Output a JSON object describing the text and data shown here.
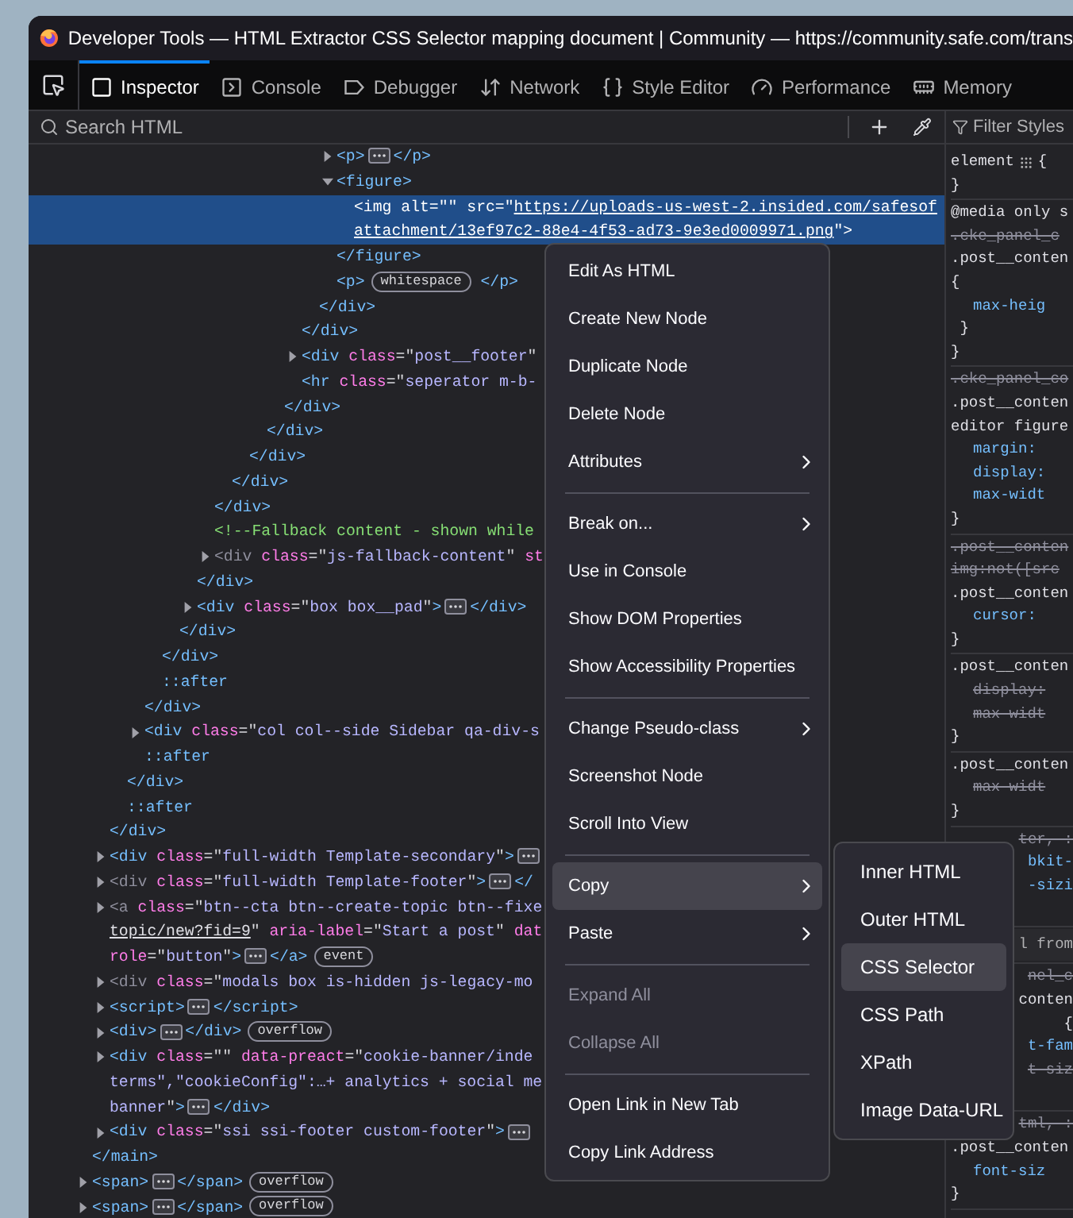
{
  "window": {
    "title": "Developer Tools — HTML Extractor CSS Selector mapping document | Community — https://community.safe.com/trans"
  },
  "tabs": [
    {
      "label": "Inspector",
      "selected": true
    },
    {
      "label": "Console",
      "selected": false
    },
    {
      "label": "Debugger",
      "selected": false
    },
    {
      "label": "Network",
      "selected": false
    },
    {
      "label": "Style Editor",
      "selected": false
    },
    {
      "label": "Performance",
      "selected": false
    },
    {
      "label": "Memory",
      "selected": false
    }
  ],
  "markup_search": {
    "placeholder": "Search HTML"
  },
  "styles_filter": {
    "placeholder": "Filter Styles"
  },
  "dom_tree": [
    {
      "children": [
        {
          "children": [
            {
              "children": [
                {
                  "children": [
                    {
                      "children": [
                        {
                          "children": [
                            {
                              "children": [
                                {
                                  "children": [
                                    {
                                      "children": [
                                        {
                                          "children": [
                                            {
                                              "children": [
                                                {
                                                  "children": [
                                                    {
                                                      "children": [
                                                        {
                                                          "children": [
                                                            {
                                                              "open": [
                                                                {
                                                                  "kind": "tag",
                                                                  "text": "<p>"
                                                                },
                                                                {
                                                                  "kind": "more"
                                                                },
                                                                {
                                                                  "kind": "tag",
                                                                  "text": "</p>"
                                                                }
                                                              ],
                                                              "expanded": false,
                                                              "selected": false
                                                            },
                                                            {
                                                              "open": [
                                                                {
                                                                  "kind": "tag",
                                                                  "text": "<figure>"
                                                                }
                                                              ],
                                                              "expanded": true,
                                                              "selected": false,
                                                              "children": [
                                                                {
                                                                  "open": [
                                                                    {
                                                                      "kind": "tag",
                                                                      "text": "<img "
                                                                    },
                                                                    {
                                                                      "kind": "attr",
                                                                      "text": "alt"
                                                                    },
                                                                    {
                                                                      "kind": "plain",
                                                                      "text": "=\"\" "
                                                                    },
                                                                    {
                                                                      "kind": "attr",
                                                                      "text": "src"
                                                                    },
                                                                    {
                                                                      "kind": "plain",
                                                                      "text": "=\""
                                                                    },
                                                                    {
                                                                      "kind": "link",
                                                                      "text": "https://uploads-us-west-2.insided.com/safesof"
                                                                    },
                                                                    {
                                                                      "kind": "break"
                                                                    },
                                                                    {
                                                                      "kind": "link",
                                                                      "text": "attachment/13ef97c2-88e4-4f53-ad73-9e3ed0009971.png"
                                                                    },
                                                                    {
                                                                      "kind": "plain",
                                                                      "text": "\""
                                                                    },
                                                                    {
                                                                      "kind": "tag",
                                                                      "text": ">"
                                                                    }
                                                                  ],
                                                                  "selected": true
                                                                }
                                                              ],
                                                              "close": [
                                                                {
                                                                  "kind": "tag",
                                                                  "text": "</figure>"
                                                                }
                                                              ]
                                                            },
                                                            {
                                                              "open": [
                                                                {
                                                                  "kind": "tag",
                                                                  "text": "<p>"
                                                                },
                                                                {
                                                                  "kind": "badge",
                                                                  "text": "whitespace"
                                                                },
                                                                {
                                                                  "kind": "tag",
                                                                  "text": " </p>"
                                                                }
                                                              ],
                                                              "selected": false
                                                            }
                                                          ],
                                                          "close": [
                                                            {
                                                              "kind": "tag",
                                                              "text": "</div>"
                                                            }
                                                          ]
                                                        }
                                                      ],
                                                      "close": [
                                                        {
                                                          "kind": "tag",
                                                          "text": "</div>"
                                                        }
                                                      ]
                                                    },
                                                    {
                                                      "open": [
                                                        {
                                                          "kind": "tag",
                                                          "text": "<div "
                                                        },
                                                        {
                                                          "kind": "attr",
                                                          "text": "class"
                                                        },
                                                        {
                                                          "kind": "plain",
                                                          "text": "=\""
                                                        },
                                                        {
                                                          "kind": "value",
                                                          "text": "post__footer"
                                                        },
                                                        {
                                                          "kind": "plain",
                                                          "text": "\""
                                                        }
                                                      ],
                                                      "expanded": false,
                                                      "selected": false
                                                    },
                                                    {
                                                      "open": [
                                                        {
                                                          "kind": "tag",
                                                          "text": "<hr "
                                                        },
                                                        {
                                                          "kind": "attr",
                                                          "text": "class"
                                                        },
                                                        {
                                                          "kind": "plain",
                                                          "text": "=\""
                                                        },
                                                        {
                                                          "kind": "value",
                                                          "text": "seperator m-b-"
                                                        }
                                                      ],
                                                      "selected": false
                                                    }
                                                  ],
                                                  "close": [
                                                    {
                                                      "kind": "tag",
                                                      "text": "</div>"
                                                    }
                                                  ]
                                                }
                                              ],
                                              "close": [
                                                {
                                                  "kind": "tag",
                                                  "text": "</div>"
                                                }
                                              ]
                                            }
                                          ],
                                          "close": [
                                            {
                                              "kind": "tag",
                                              "text": "</div>"
                                            }
                                          ]
                                        }
                                      ],
                                      "close": [
                                        {
                                          "kind": "tag",
                                          "text": "</div>"
                                        }
                                      ]
                                    }
                                  ],
                                  "close": [
                                    {
                                      "kind": "tag",
                                      "text": "</div>"
                                    }
                                  ]
                                },
                                {
                                  "open": [
                                    {
                                      "kind": "comment",
                                      "text": "<!--Fallback content - shown while"
                                    }
                                  ],
                                  "selected": false
                                },
                                {
                                  "open": [
                                    {
                                      "kind": "dim",
                                      "text": "<div "
                                    },
                                    {
                                      "kind": "attr",
                                      "text": "class"
                                    },
                                    {
                                      "kind": "plain",
                                      "text": "=\""
                                    },
                                    {
                                      "kind": "value",
                                      "text": "js-fallback-content"
                                    },
                                    {
                                      "kind": "plain",
                                      "text": "\" "
                                    },
                                    {
                                      "kind": "attr",
                                      "text": "st"
                                    }
                                  ],
                                  "expanded": false,
                                  "selected": false
                                }
                              ],
                              "close": [
                                {
                                  "kind": "tag",
                                  "text": "</div>"
                                }
                              ]
                            },
                            {
                              "open": [
                                {
                                  "kind": "tag",
                                  "text": "<div "
                                },
                                {
                                  "kind": "attr",
                                  "text": "class"
                                },
                                {
                                  "kind": "plain",
                                  "text": "=\""
                                },
                                {
                                  "kind": "value",
                                  "text": "box box__pad"
                                },
                                {
                                  "kind": "plain",
                                  "text": "\""
                                },
                                {
                                  "kind": "tag",
                                  "text": ">"
                                },
                                {
                                  "kind": "more"
                                },
                                {
                                  "kind": "tag",
                                  "text": "</div>"
                                }
                              ],
                              "expanded": false,
                              "selected": false
                            }
                          ],
                          "close": [
                            {
                              "kind": "tag",
                              "text": "</div>"
                            }
                          ]
                        }
                      ],
                      "close": [
                        {
                          "kind": "tag",
                          "text": "</div>"
                        }
                      ]
                    },
                    {
                      "open": [
                        {
                          "kind": "tag",
                          "text": "::after"
                        }
                      ],
                      "selected": false
                    }
                  ],
                  "close": [
                    {
                      "kind": "tag",
                      "text": "</div>"
                    }
                  ]
                },
                {
                  "open": [
                    {
                      "kind": "tag",
                      "text": "<div "
                    },
                    {
                      "kind": "attr",
                      "text": "class"
                    },
                    {
                      "kind": "plain",
                      "text": "=\""
                    },
                    {
                      "kind": "value",
                      "text": "col col--side Sidebar qa-div-s"
                    }
                  ],
                  "expanded": false,
                  "selected": false
                },
                {
                  "open": [
                    {
                      "kind": "tag",
                      "text": "::after"
                    }
                  ],
                  "selected": false
                }
              ],
              "close": [
                {
                  "kind": "tag",
                  "text": "</div>"
                }
              ]
            },
            {
              "open": [
                {
                  "kind": "tag",
                  "text": "::after"
                }
              ],
              "selected": false
            }
          ],
          "close": [
            {
              "kind": "tag",
              "text": "</div>"
            }
          ]
        },
        {
          "open": [
            {
              "kind": "tag",
              "text": "<div "
            },
            {
              "kind": "attr",
              "text": "class"
            },
            {
              "kind": "plain",
              "text": "=\""
            },
            {
              "kind": "value",
              "text": "full-width Template-secondary"
            },
            {
              "kind": "plain",
              "text": "\""
            },
            {
              "kind": "tag",
              "text": ">"
            },
            {
              "kind": "more"
            }
          ],
          "expanded": false,
          "selected": false
        },
        {
          "open": [
            {
              "kind": "dim",
              "text": "<div "
            },
            {
              "kind": "attr",
              "text": "class"
            },
            {
              "kind": "plain",
              "text": "=\""
            },
            {
              "kind": "value",
              "text": "full-width Template-footer"
            },
            {
              "kind": "plain",
              "text": "\""
            },
            {
              "kind": "tag",
              "text": ">"
            },
            {
              "kind": "more"
            },
            {
              "kind": "tag",
              "text": "</"
            }
          ],
          "expanded": false,
          "selected": false
        },
        {
          "open": [
            {
              "kind": "dim",
              "text": "<a "
            },
            {
              "kind": "attr",
              "text": "class"
            },
            {
              "kind": "plain",
              "text": "=\""
            },
            {
              "kind": "value",
              "text": "btn--cta btn--create-topic btn--fixe"
            },
            {
              "kind": "break"
            },
            {
              "kind": "link",
              "text": "topic/new?fid=9"
            },
            {
              "kind": "plain",
              "text": "\" "
            },
            {
              "kind": "attr",
              "text": "aria-label"
            },
            {
              "kind": "plain",
              "text": "=\""
            },
            {
              "kind": "value",
              "text": "Start a post"
            },
            {
              "kind": "plain",
              "text": "\" "
            },
            {
              "kind": "attr",
              "text": "dat"
            },
            {
              "kind": "break"
            },
            {
              "kind": "attr",
              "text": "role"
            },
            {
              "kind": "plain",
              "text": "=\""
            },
            {
              "kind": "value",
              "text": "button"
            },
            {
              "kind": "plain",
              "text": "\""
            },
            {
              "kind": "tag",
              "text": ">"
            },
            {
              "kind": "more"
            },
            {
              "kind": "tag",
              "text": "</a>"
            },
            {
              "kind": "badge",
              "text": "event"
            }
          ],
          "expanded": false,
          "selected": false
        },
        {
          "open": [
            {
              "kind": "dim",
              "text": "<div "
            },
            {
              "kind": "attr",
              "text": "class"
            },
            {
              "kind": "plain",
              "text": "=\""
            },
            {
              "kind": "value",
              "text": "modals box is-hidden js-legacy-mo"
            }
          ],
          "expanded": false,
          "selected": false
        },
        {
          "open": [
            {
              "kind": "tag",
              "text": "<script>"
            },
            {
              "kind": "more"
            },
            {
              "kind": "tag",
              "text": "</script>"
            }
          ],
          "expanded": false,
          "selected": false
        },
        {
          "open": [
            {
              "kind": "tag",
              "text": "<div>"
            },
            {
              "kind": "more"
            },
            {
              "kind": "tag",
              "text": "</div>"
            },
            {
              "kind": "badge",
              "text": "overflow"
            }
          ],
          "expanded": false,
          "selected": false
        },
        {
          "open": [
            {
              "kind": "tag",
              "text": "<div "
            },
            {
              "kind": "attr",
              "text": "class"
            },
            {
              "kind": "plain",
              "text": "=\"\" "
            },
            {
              "kind": "attr",
              "text": "data-preact"
            },
            {
              "kind": "plain",
              "text": "=\""
            },
            {
              "kind": "value",
              "text": "cookie-banner/inde"
            },
            {
              "kind": "break"
            },
            {
              "kind": "value",
              "text": "terms\",\"cookieConfig\":…+ analytics + social me"
            },
            {
              "kind": "break"
            },
            {
              "kind": "value",
              "text": "banner"
            },
            {
              "kind": "plain",
              "text": "\""
            },
            {
              "kind": "tag",
              "text": ">"
            },
            {
              "kind": "more"
            },
            {
              "kind": "tag",
              "text": "</div>"
            }
          ],
          "expanded": false,
          "selected": false
        },
        {
          "open": [
            {
              "kind": "tag",
              "text": "<div "
            },
            {
              "kind": "attr",
              "text": "class"
            },
            {
              "kind": "plain",
              "text": "=\""
            },
            {
              "kind": "value",
              "text": "ssi ssi-footer custom-footer"
            },
            {
              "kind": "plain",
              "text": "\""
            },
            {
              "kind": "tag",
              "text": ">"
            },
            {
              "kind": "more"
            }
          ],
          "expanded": false,
          "selected": false
        }
      ],
      "close": [
        {
          "kind": "tag",
          "text": "</main>"
        }
      ]
    },
    {
      "open": [
        {
          "kind": "tag",
          "text": "<span>"
        },
        {
          "kind": "more"
        },
        {
          "kind": "tag",
          "text": "</span>"
        },
        {
          "kind": "badge",
          "text": "overflow"
        }
      ],
      "expanded": false,
      "selected": false
    },
    {
      "open": [
        {
          "kind": "tag",
          "text": "<span>"
        },
        {
          "kind": "more"
        },
        {
          "kind": "tag",
          "text": "</span>"
        },
        {
          "kind": "badge",
          "text": "overflow"
        }
      ],
      "expanded": false,
      "selected": false
    }
  ],
  "style_rules": [
    {
      "lines": [
        {
          "kind": "element",
          "text": "element",
          "suffix": "{",
          "strike": false
        },
        {
          "kind": "sel",
          "text": "}",
          "strike": false
        }
      ]
    },
    {
      "lines": [
        {
          "kind": "sel",
          "text": "@media only s",
          "strike": false
        },
        {
          "kind": "sel",
          "text": ".cke_panel_c",
          "strike": true
        },
        {
          "kind": "sel",
          "text": ".post__conten",
          "strike": false
        },
        {
          "kind": "sel",
          "text": "{",
          "strike": false
        },
        {
          "kind": "prop",
          "text": "max-heig",
          "strike": false
        },
        {
          "kind": "sel",
          "text": " }",
          "strike": false
        },
        {
          "kind": "sel",
          "text": "}",
          "strike": false
        }
      ]
    },
    {
      "lines": [
        {
          "kind": "sel",
          "text": ".cke_panel_co",
          "strike": true
        },
        {
          "kind": "sel",
          "text": ".post__conten",
          "strike": false
        },
        {
          "kind": "sel",
          "text": "editor figure",
          "strike": false
        },
        {
          "kind": "prop",
          "text": "margin:",
          "strike": false
        },
        {
          "kind": "prop",
          "text": "display:",
          "strike": false
        },
        {
          "kind": "prop",
          "text": "max-widt",
          "strike": false
        },
        {
          "kind": "sel",
          "text": "}",
          "strike": false
        }
      ]
    },
    {
      "lines": [
        {
          "kind": "sel",
          "text": ".post__conten",
          "strike": true
        },
        {
          "kind": "sel",
          "text": "img:not([src",
          "strike": true
        },
        {
          "kind": "sel",
          "text": ".post__conten",
          "strike": false
        },
        {
          "kind": "prop",
          "text": "cursor:",
          "strike": false
        },
        {
          "kind": "sel",
          "text": "}",
          "strike": false
        }
      ]
    },
    {
      "lines": [
        {
          "kind": "sel",
          "text": ".post__conten",
          "strike": false
        },
        {
          "kind": "prop",
          "text": "display:",
          "strike": true
        },
        {
          "kind": "prop",
          "text": "max-widt",
          "strike": true
        },
        {
          "kind": "sel",
          "text": "}",
          "strike": false
        }
      ]
    },
    {
      "lines": [
        {
          "kind": "sel",
          "text": ".post__conten",
          "strike": false
        },
        {
          "kind": "prop",
          "text": "max-widt",
          "strike": true
        },
        {
          "kind": "sel",
          "text": "}",
          "strike": false
        }
      ]
    },
    {
      "lines": [
        {
          "kind": "partial",
          "text": "ter, :",
          "strike": true
        },
        {
          "kind": "partial-prop",
          "text": "bkit-",
          "strike": false
        },
        {
          "kind": "partial-prop",
          "text": "-sizi",
          "strike": false
        }
      ]
    },
    {
      "lines": [
        {
          "kind": "head",
          "text": "l from",
          "strike": false
        }
      ]
    },
    {
      "lines": [
        {
          "kind": "partial",
          "text": "nel_c",
          "strike": true
        },
        {
          "kind": "partial",
          "text": "conten",
          "strike": false
        },
        {
          "kind": "partial",
          "text": "{",
          "strike": false
        },
        {
          "kind": "partial-prop",
          "text": "t-fam",
          "strike": false
        },
        {
          "kind": "partial-prop",
          "text": "t-siz",
          "strike": true
        }
      ]
    },
    {
      "lines": [
        {
          "kind": "partial",
          "text": "tml, :",
          "strike": true
        },
        {
          "kind": "sel",
          "text": ".post__conten",
          "strike": false
        },
        {
          "kind": "prop",
          "text": "font-siz",
          "strike": false
        },
        {
          "kind": "sel",
          "text": "}",
          "strike": false
        }
      ]
    }
  ],
  "context_menu": {
    "items": [
      {
        "kind": "item",
        "label": "Edit As HTML",
        "submenu": false,
        "selected": false,
        "disabled": false
      },
      {
        "kind": "item",
        "label": "Create New Node",
        "submenu": false,
        "selected": false,
        "disabled": false
      },
      {
        "kind": "item",
        "label": "Duplicate Node",
        "submenu": false,
        "selected": false,
        "disabled": false
      },
      {
        "kind": "item",
        "label": "Delete Node",
        "submenu": false,
        "selected": false,
        "disabled": false
      },
      {
        "kind": "item",
        "label": "Attributes",
        "submenu": true,
        "selected": false,
        "disabled": false
      },
      {
        "kind": "separator"
      },
      {
        "kind": "item",
        "label": "Break on...",
        "submenu": true,
        "selected": false,
        "disabled": false
      },
      {
        "kind": "item",
        "label": "Use in Console",
        "submenu": false,
        "selected": false,
        "disabled": false
      },
      {
        "kind": "item",
        "label": "Show DOM Properties",
        "submenu": false,
        "selected": false,
        "disabled": false
      },
      {
        "kind": "item",
        "label": "Show Accessibility Properties",
        "submenu": false,
        "selected": false,
        "disabled": false
      },
      {
        "kind": "separator"
      },
      {
        "kind": "item",
        "label": "Change Pseudo-class",
        "submenu": true,
        "selected": false,
        "disabled": false
      },
      {
        "kind": "item",
        "label": "Screenshot Node",
        "submenu": false,
        "selected": false,
        "disabled": false
      },
      {
        "kind": "item",
        "label": "Scroll Into View",
        "submenu": false,
        "selected": false,
        "disabled": false
      },
      {
        "kind": "separator"
      },
      {
        "kind": "item",
        "label": "Copy",
        "submenu": true,
        "selected": true,
        "disabled": false
      },
      {
        "kind": "item",
        "label": "Paste",
        "submenu": true,
        "selected": false,
        "disabled": false
      },
      {
        "kind": "separator"
      },
      {
        "kind": "item",
        "label": "Expand All",
        "submenu": false,
        "selected": false,
        "disabled": true
      },
      {
        "kind": "item",
        "label": "Collapse All",
        "submenu": false,
        "selected": false,
        "disabled": true
      },
      {
        "kind": "separator"
      },
      {
        "kind": "item",
        "label": "Open Link in New Tab",
        "submenu": false,
        "selected": false,
        "disabled": false
      },
      {
        "kind": "item",
        "label": "Copy Link Address",
        "submenu": false,
        "selected": false,
        "disabled": false
      }
    ]
  },
  "copy_submenu": {
    "items": [
      {
        "label": "Inner HTML",
        "selected": false
      },
      {
        "label": "Outer HTML",
        "selected": false
      },
      {
        "label": "CSS Selector",
        "selected": true
      },
      {
        "label": "CSS Path",
        "selected": false
      },
      {
        "label": "XPath",
        "selected": false
      },
      {
        "label": "Image Data-URL",
        "selected": false
      }
    ]
  }
}
